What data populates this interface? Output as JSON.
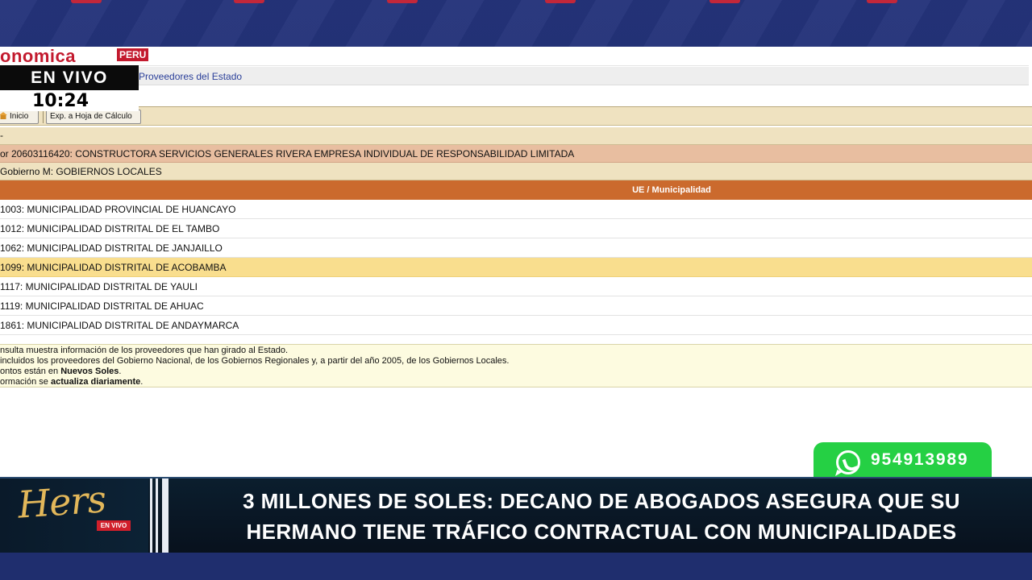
{
  "colors": {
    "broadcast_blue": "#1f2e6e",
    "brand_red": "#c31a2e",
    "toolbar_beige": "#efe2c0",
    "proveedor_row": "#e8bea0",
    "table_header_orange": "#cb6a2d",
    "row_highlight": "#f9de8e",
    "whatsapp_green": "#25d044",
    "lower_third_bg": "#08111d",
    "logo_gold": "#e2b75a"
  },
  "webpage": {
    "logo_text": "onomica",
    "logo_badge": "PERU",
    "breadcrumb": "Proveedores del Estado",
    "toolbar": {
      "inicio_label": "Inicio",
      "inicio_icon": "home-icon",
      "export_label": "Exp. a Hoja de Cálculo"
    },
    "dash_row": "-",
    "proveedor": "or 20603116420: CONSTRUCTORA SERVICIOS GENERALES RIVERA EMPRESA INDIVIDUAL DE RESPONSABILIDAD LIMITADA",
    "gobierno": "Gobierno M: GOBIERNOS LOCALES",
    "table": {
      "header": "UE / Municipalidad",
      "rows": [
        "1003: MUNICIPALIDAD PROVINCIAL DE HUANCAYO",
        "1012: MUNICIPALIDAD DISTRITAL DE EL TAMBO",
        "1062: MUNICIPALIDAD DISTRITAL DE JANJAILLO",
        "1099: MUNICIPALIDAD DISTRITAL DE ACOBAMBA",
        "1117: MUNICIPALIDAD DISTRITAL DE YAULI",
        "1119: MUNICIPALIDAD DISTRITAL DE AHUAC",
        "1861: MUNICIPALIDAD DISTRITAL DE ANDAYMARCA"
      ],
      "highlighted_index": 3
    },
    "footnotes": {
      "line1": "nsulta muestra información de los proveedores que han girado al Estado.",
      "line2": "incluidos los proveedores del Gobierno Nacional, de los Gobiernos Regionales y, a partir del año 2005, de los Gobiernos Locales.",
      "line3_pre": "ontos están en ",
      "line3_bold": "Nuevos Soles",
      "line3_post": ".",
      "line4_pre": "ormación se ",
      "line4_bold": "actualiza diariamente",
      "line4_post": "."
    }
  },
  "live": {
    "label": "EN VIVO",
    "time": "10:24"
  },
  "whatsapp": {
    "icon": "whatsapp-icon",
    "number": "954913989"
  },
  "lower_third": {
    "logo": "Hers",
    "logo_tag": "EN VIVO",
    "headline_line1": "3 MILLONES DE SOLES: DECANO DE ABOGADOS ASEGURA QUE SU",
    "headline_line2": "HERMANO TIENE TRÁFICO CONTRACTUAL  CON MUNICIPALIDADES"
  }
}
